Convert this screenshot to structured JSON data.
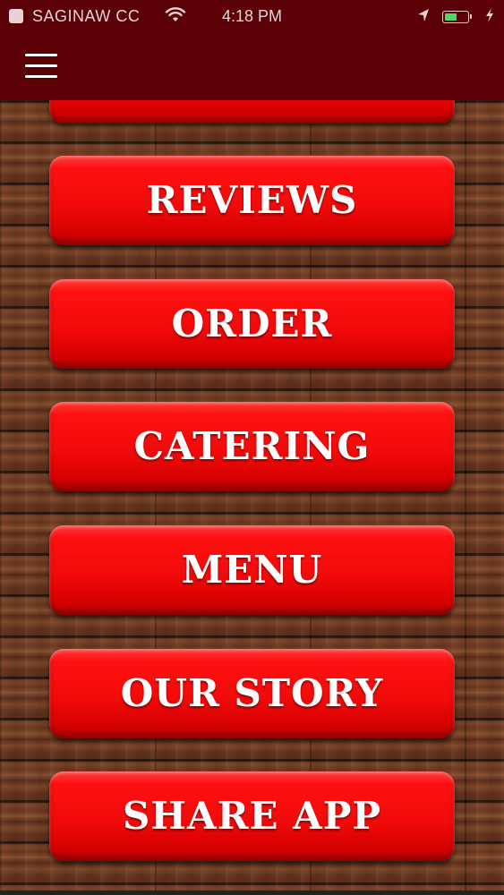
{
  "status_bar": {
    "carrier": "SAGINAW CC",
    "wifi": "wifi-icon",
    "time": "4:18 PM",
    "location": "location-arrow-icon",
    "battery_level": 0.55,
    "charging": "charging-bolt-icon"
  },
  "header": {
    "menu_icon": "hamburger-menu-icon",
    "background_color": "#5a0006"
  },
  "menu": {
    "accent_color": "#ff1010",
    "items": [
      {
        "label": ""
      },
      {
        "label": "REVIEWS"
      },
      {
        "label": "ORDER"
      },
      {
        "label": "CATERING"
      },
      {
        "label": "MENU"
      },
      {
        "label": "OUR STORY"
      },
      {
        "label": "SHARE APP"
      }
    ]
  }
}
